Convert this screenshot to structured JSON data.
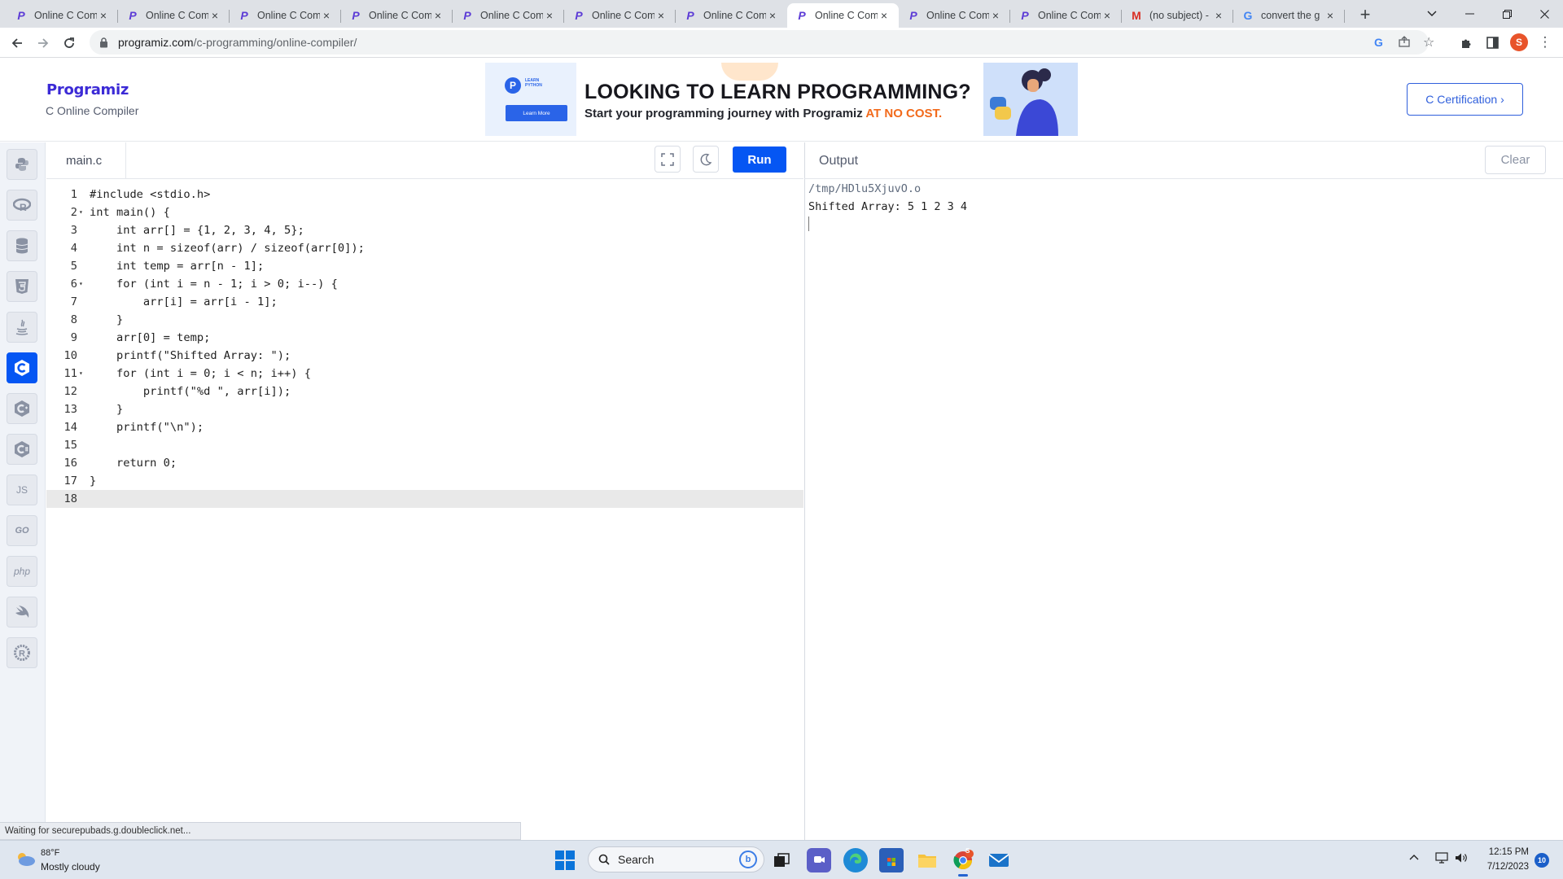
{
  "browser": {
    "tabs": [
      {
        "label": "Online C Com",
        "favicon": "programiz-icon",
        "active": false
      },
      {
        "label": "Online C Com",
        "favicon": "programiz-icon",
        "active": false
      },
      {
        "label": "Online C Com",
        "favicon": "programiz-icon",
        "active": false
      },
      {
        "label": "Online C Com",
        "favicon": "programiz-icon",
        "active": false
      },
      {
        "label": "Online C Com",
        "favicon": "programiz-icon",
        "active": false
      },
      {
        "label": "Online C Com",
        "favicon": "programiz-icon",
        "active": false
      },
      {
        "label": "Online C Com",
        "favicon": "programiz-icon",
        "active": false
      },
      {
        "label": "Online C Com",
        "favicon": "programiz-icon",
        "active": true
      },
      {
        "label": "Online C Com",
        "favicon": "programiz-icon",
        "active": false
      },
      {
        "label": "Online C Com",
        "favicon": "programiz-icon",
        "active": false
      },
      {
        "label": "(no subject) -",
        "favicon": "gmail-icon",
        "active": false
      },
      {
        "label": "convert the g",
        "favicon": "google-icon",
        "active": false
      }
    ],
    "url_domain": "programiz.com",
    "url_path": "/c-programming/online-compiler/",
    "profile_initial": "S"
  },
  "site": {
    "logo_text": "Programiz",
    "subtitle": "C Online Compiler",
    "ad": {
      "badge": "LEARN PYTHON",
      "learn_more": "Learn More",
      "headline": "LOOKING TO LEARN PROGRAMMING?",
      "sub_text": "Start your programming journey with Programiz ",
      "sub_highlight": "AT NO COST."
    },
    "cert_button": "C Certification ›"
  },
  "sidebar": {
    "languages": [
      {
        "name": "python",
        "label": ""
      },
      {
        "name": "r",
        "label": "R"
      },
      {
        "name": "sql",
        "label": ""
      },
      {
        "name": "html",
        "label": "5"
      },
      {
        "name": "java",
        "label": ""
      },
      {
        "name": "c",
        "label": "C",
        "active": true
      },
      {
        "name": "cpp",
        "label": "C"
      },
      {
        "name": "csharp",
        "label": "C"
      },
      {
        "name": "js",
        "label": "JS"
      },
      {
        "name": "go",
        "label": "GO"
      },
      {
        "name": "php",
        "label": "php"
      },
      {
        "name": "swift",
        "label": ""
      },
      {
        "name": "rust",
        "label": "R"
      }
    ]
  },
  "editor": {
    "filename": "main.c",
    "run_label": "Run",
    "lines": [
      "#include <stdio.h>",
      "int main() {",
      "    int arr[] = {1, 2, 3, 4, 5};",
      "    int n = sizeof(arr) / sizeof(arr[0]);",
      "    int temp = arr[n - 1];",
      "    for (int i = n - 1; i > 0; i--) {",
      "        arr[i] = arr[i - 1];",
      "    }",
      "    arr[0] = temp;",
      "    printf(\"Shifted Array: \");",
      "    for (int i = 0; i < n; i++) {",
      "        printf(\"%d \", arr[i]);",
      "    }",
      "    printf(\"\\n\");",
      "",
      "    return 0;",
      "}",
      ""
    ],
    "fold_lines": [
      2,
      6,
      11
    ],
    "current_line": 18
  },
  "output": {
    "title": "Output",
    "clear_label": "Clear",
    "lines": [
      "/tmp/HDlu5XjuvO.o",
      "Shifted Array: 5 1 2 3 4"
    ]
  },
  "status_text": "Waiting for securepubads.g.doubleclick.net...",
  "taskbar": {
    "temperature": "88°F",
    "condition": "Mostly cloudy",
    "search_placeholder": "Search",
    "time": "12:15 PM",
    "date": "7/12/2023",
    "notification_count": "10",
    "chrome_badge": "S"
  },
  "colors": {
    "accent": "#0556f3",
    "brand": "#3b2ad6",
    "ad_highlight": "#f26a1b"
  }
}
